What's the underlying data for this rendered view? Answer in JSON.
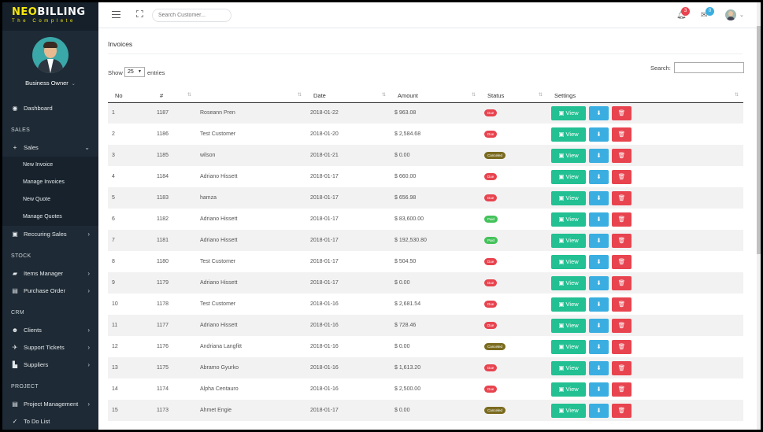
{
  "brand": {
    "part1": "NEO",
    "part2": "BILLING",
    "tagline": "The Complete"
  },
  "profile": {
    "role": "Business Owner"
  },
  "sidebar": {
    "dashboard": "Dashboard",
    "sales_section": "SALES",
    "sales": "Sales",
    "new_invoice": "New Invoice",
    "manage_invoices": "Manage Invoices",
    "new_quote": "New Quote",
    "manage_quotes": "Manage Quotes",
    "recurring_sales": "Reccuring Sales",
    "stock_section": "STOCK",
    "items_manager": "Items Manager",
    "purchase_order": "Purchase Order",
    "crm_section": "CRM",
    "clients": "Clients",
    "support_tickets": "Support Tickets",
    "suppliers": "Suppliers",
    "project_section": "PROJECT",
    "project_management": "Project Management",
    "todo_list": "To Do List"
  },
  "topbar": {
    "search_placeholder": "Search Customer...",
    "notifications_count": "3",
    "messages_count": "0"
  },
  "page": {
    "title": "Invoices",
    "show_label": "Show",
    "page_length": "25",
    "entries_label": "entries",
    "search_label": "Search:"
  },
  "table": {
    "headers": [
      "No",
      "#",
      "",
      "Date",
      "Amount",
      "Status",
      "Settings"
    ],
    "view_label": "View",
    "rows": [
      {
        "no": "1",
        "id": "1187",
        "customer": "Roseann Pren",
        "date": "2018-01-22",
        "amount": "$ 963.08",
        "status": "Due",
        "status_color": "#e8444f"
      },
      {
        "no": "2",
        "id": "1186",
        "customer": "Test Customer",
        "date": "2018-01-20",
        "amount": "$ 2,584.68",
        "status": "Due",
        "status_color": "#e8444f"
      },
      {
        "no": "3",
        "id": "1185",
        "customer": "wilson",
        "date": "2018-01-21",
        "amount": "$ 0.00",
        "status": "Canceled",
        "status_color": "#7a6b1f"
      },
      {
        "no": "4",
        "id": "1184",
        "customer": "Adriano Hissett",
        "date": "2018-01-17",
        "amount": "$ 660.00",
        "status": "Due",
        "status_color": "#e8444f"
      },
      {
        "no": "5",
        "id": "1183",
        "customer": "hamza",
        "date": "2018-01-17",
        "amount": "$ 656.98",
        "status": "Due",
        "status_color": "#e8444f"
      },
      {
        "no": "6",
        "id": "1182",
        "customer": "Adriano Hissett",
        "date": "2018-01-17",
        "amount": "$ 83,600.00",
        "status": "Paid",
        "status_color": "#43c25a"
      },
      {
        "no": "7",
        "id": "1181",
        "customer": "Adriano Hissett",
        "date": "2018-01-17",
        "amount": "$ 192,530.80",
        "status": "Paid",
        "status_color": "#43c25a"
      },
      {
        "no": "8",
        "id": "1180",
        "customer": "Test Customer",
        "date": "2018-01-17",
        "amount": "$ 504.50",
        "status": "Due",
        "status_color": "#e8444f"
      },
      {
        "no": "9",
        "id": "1179",
        "customer": "Adriano Hissett",
        "date": "2018-01-17",
        "amount": "$ 0.00",
        "status": "Due",
        "status_color": "#e8444f"
      },
      {
        "no": "10",
        "id": "1178",
        "customer": "Test Customer",
        "date": "2018-01-16",
        "amount": "$ 2,681.54",
        "status": "Due",
        "status_color": "#e8444f"
      },
      {
        "no": "11",
        "id": "1177",
        "customer": "Adriano Hissett",
        "date": "2018-01-16",
        "amount": "$ 728.46",
        "status": "Due",
        "status_color": "#e8444f"
      },
      {
        "no": "12",
        "id": "1176",
        "customer": "Andriana Langfitt",
        "date": "2018-01-16",
        "amount": "$ 0.00",
        "status": "Canceled",
        "status_color": "#7a6b1f"
      },
      {
        "no": "13",
        "id": "1175",
        "customer": "Abramo Gyurko",
        "date": "2018-01-16",
        "amount": "$ 1,613.20",
        "status": "Due",
        "status_color": "#e8444f"
      },
      {
        "no": "14",
        "id": "1174",
        "customer": "Alpha Centauro",
        "date": "2018-01-16",
        "amount": "$ 2,500.00",
        "status": "Due",
        "status_color": "#e8444f"
      },
      {
        "no": "15",
        "id": "1173",
        "customer": "Ahmet Engie",
        "date": "2018-01-17",
        "amount": "$ 0.00",
        "status": "Canceled",
        "status_color": "#7a6b1f"
      }
    ]
  }
}
